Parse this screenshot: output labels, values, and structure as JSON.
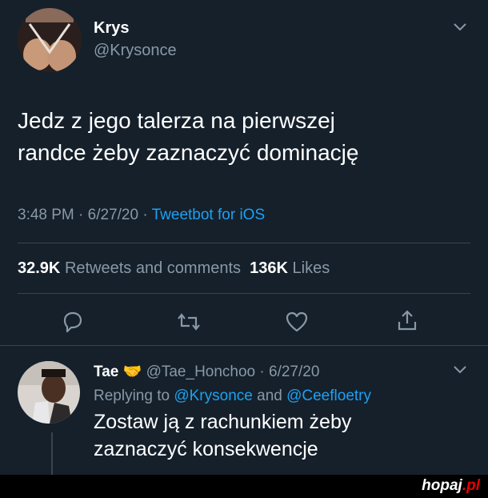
{
  "tweet": {
    "author_name": "Krys",
    "author_handle": "@Krysonce",
    "text_line1": "Jedz z jego talerza na pierwszej",
    "text_line2": "randce żeby zaznaczyć dominację",
    "time": "3:48 PM",
    "date": "6/27/20",
    "separator": " · ",
    "source": "Tweetbot for iOS",
    "retweets_count": "32.9K",
    "retweets_label": "Retweets and comments",
    "likes_count": "136K",
    "likes_label": "Likes"
  },
  "actions": [
    "reply-icon",
    "retweet-icon",
    "like-icon",
    "share-icon"
  ],
  "reply": {
    "author_name": "Tae",
    "author_handle": "@Tae_Honchoo",
    "date": "6/27/20",
    "replying_prefix": "Replying to",
    "mention1": "@Krysonce",
    "and_word": "and",
    "mention2": "@Ceefloetry",
    "text_line1": "Zostaw ją z rachunkiem żeby",
    "text_line2": "zaznaczyć konsekwencje"
  },
  "footer": {
    "brand": "hopaj",
    "brand_suffix": ".pl"
  },
  "colors": {
    "background": "#15202b",
    "accent": "#1da1f2",
    "secondary_text": "#8899a6",
    "brand_red": "#e60000"
  }
}
